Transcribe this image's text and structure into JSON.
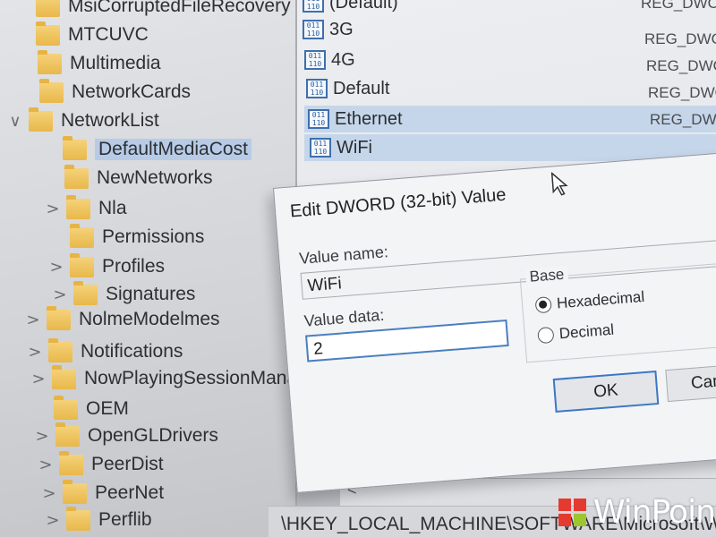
{
  "tree": {
    "items": [
      {
        "label": "MsiCorruptedFileRecovery",
        "chevron": ""
      },
      {
        "label": "MTCUVC",
        "chevron": ""
      },
      {
        "label": "Multimedia",
        "chevron": ""
      },
      {
        "label": "NetworkCards",
        "chevron": ""
      },
      {
        "label": "NetworkList",
        "chevron": "∨"
      },
      {
        "label": "DefaultMediaCost",
        "chevron": ""
      },
      {
        "label": "NewNetworks",
        "chevron": ""
      },
      {
        "label": "Nla",
        "chevron": ">"
      },
      {
        "label": "Permissions",
        "chevron": ""
      },
      {
        "label": "Profiles",
        "chevron": ">"
      },
      {
        "label": "Signatures",
        "chevron": ">"
      },
      {
        "label": "NolmeModelmes",
        "chevron": ">"
      },
      {
        "label": "Notifications",
        "chevron": ">"
      },
      {
        "label": "NowPlayingSessionManager",
        "chevron": ">"
      },
      {
        "label": "OEM",
        "chevron": ""
      },
      {
        "label": "OpenGLDrivers",
        "chevron": ">"
      },
      {
        "label": "PeerDist",
        "chevron": ">"
      },
      {
        "label": "PeerNet",
        "chevron": ">"
      },
      {
        "label": "Perflib",
        "chevron": ">"
      }
    ]
  },
  "values": {
    "rows": [
      {
        "name": "(Default)",
        "type": "REG_DWORD"
      },
      {
        "name": "3G",
        "type": "REG_DWORD"
      },
      {
        "name": "4G",
        "type": "REG_DWORD"
      },
      {
        "name": "Default",
        "type": "REG_DWORD"
      },
      {
        "name": "Ethernet",
        "type": "REG_DWORD"
      },
      {
        "name": "WiFi",
        "type": ""
      }
    ],
    "icon_text": "011\n110"
  },
  "dialog": {
    "title": "Edit DWORD (32-bit) Value",
    "value_name_label": "Value name:",
    "value_name": "WiFi",
    "value_data_label": "Value data:",
    "value_data": "2",
    "base_label": "Base",
    "hex_label": "Hexadecimal",
    "dec_label": "Decimal",
    "base_selected": "Hexadecimal",
    "ok_label": "OK",
    "cancel_label": "Cancel"
  },
  "status_bar": {
    "path": "\\HKEY_LOCAL_MACHINE\\SOFTWARE\\Microsoft\\Windows NT\\CurrentVersion\\NetworkList"
  },
  "scroll": {
    "left_arrow": "<"
  },
  "watermark": {
    "text": "WinPoin",
    "colors": [
      "#e53a2f",
      "#e53a2f",
      "#e53a2f",
      "#9cc52e"
    ]
  },
  "colors": {
    "selection": "#c6d6ea",
    "focus_border": "#4a7fc1",
    "folder": "#e8b84a"
  }
}
